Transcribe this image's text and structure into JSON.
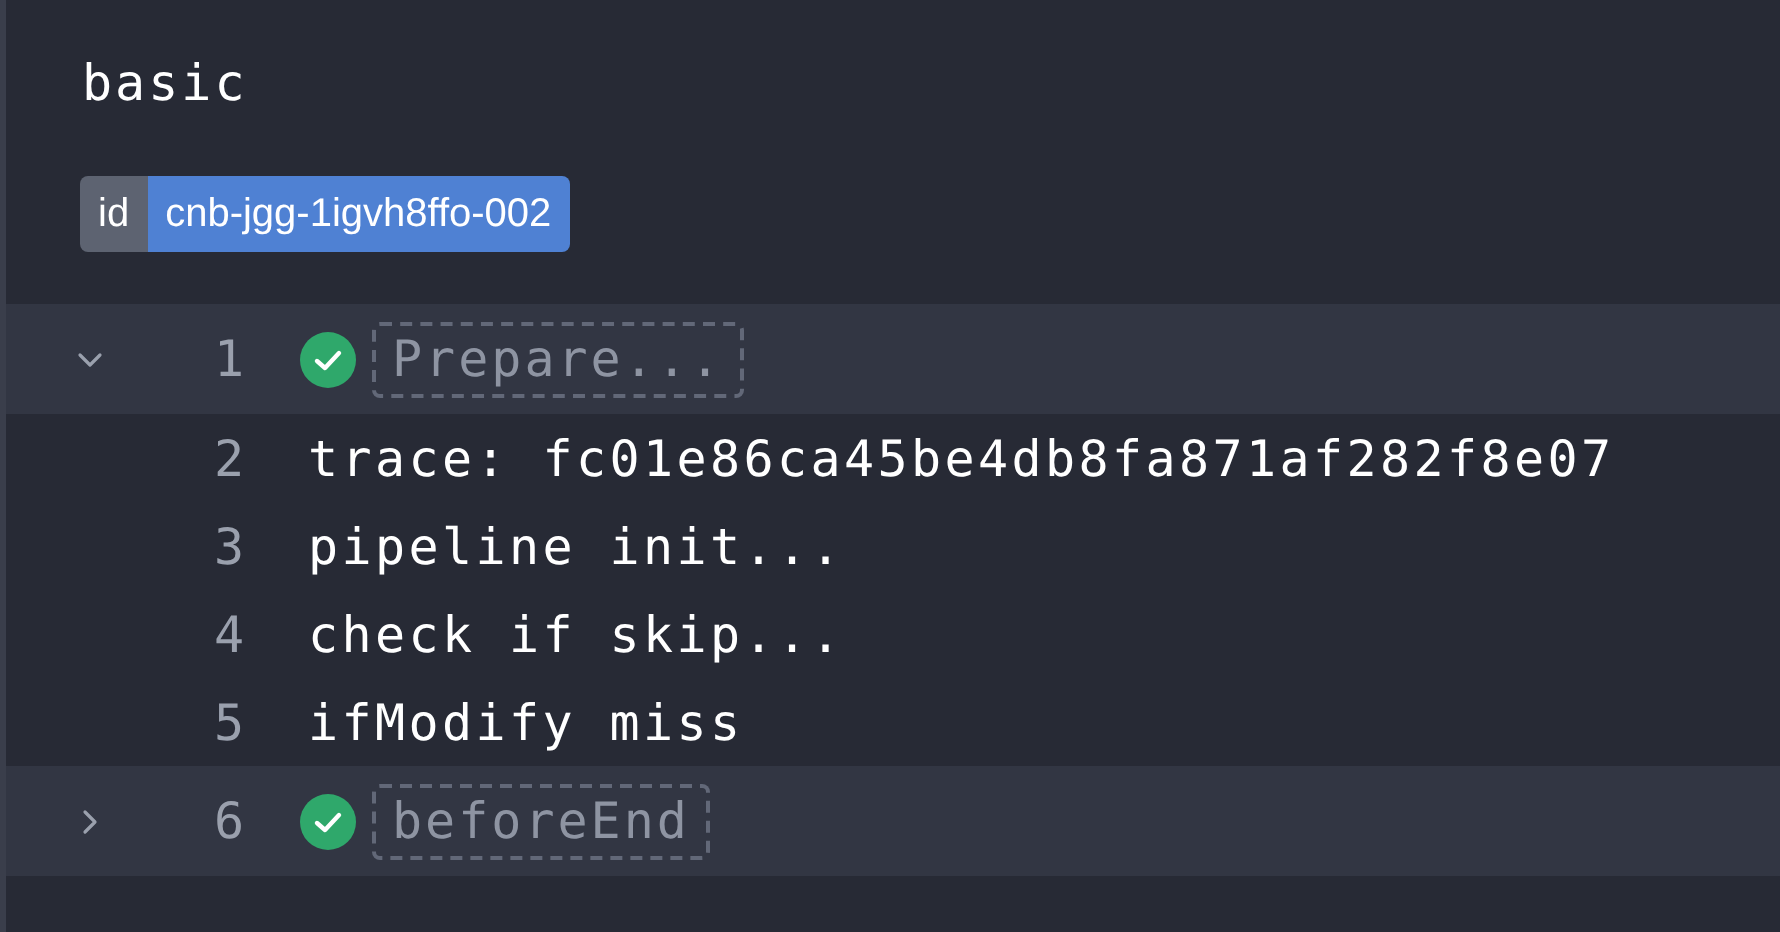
{
  "title": "basic",
  "badge": {
    "key": "id",
    "value": "cnb-jgg-1igvh8ffo-002"
  },
  "groups": [
    {
      "number": "1",
      "expanded": true,
      "done": true,
      "title": "Prepare...",
      "lines": [
        {
          "number": "2",
          "text": "trace: fc01e86ca45be4db8fa871af282f8e07"
        },
        {
          "number": "3",
          "text": "pipeline init..."
        },
        {
          "number": "4",
          "text": "check if skip..."
        },
        {
          "number": "5",
          "text": "ifModify miss"
        }
      ]
    },
    {
      "number": "6",
      "expanded": false,
      "done": true,
      "title": "beforeEnd"
    }
  ]
}
